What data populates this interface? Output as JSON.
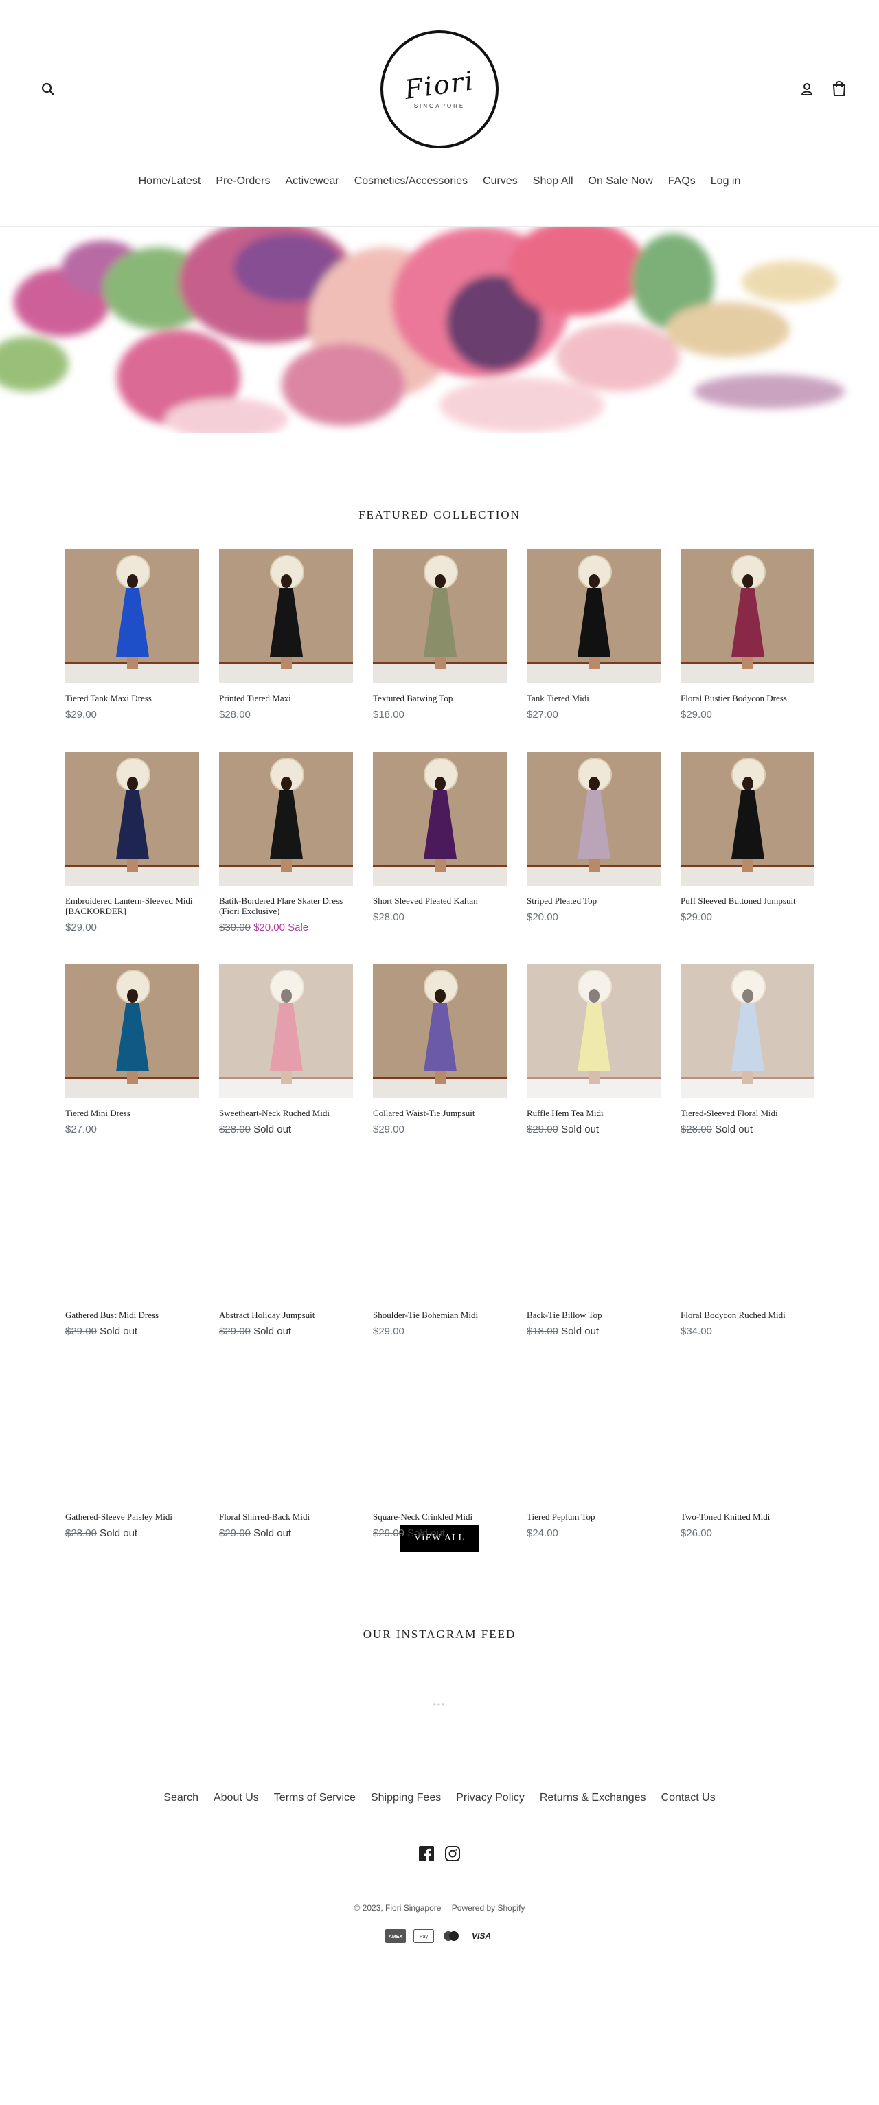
{
  "header": {
    "logo_text": "Fiori",
    "logo_subtext": "SINGAPORE",
    "nav": [
      "Home/Latest",
      "Pre-Orders",
      "Activewear",
      "Cosmetics/Accessories",
      "Curves",
      "Shop All",
      "On Sale Now",
      "FAQs",
      "Log in"
    ]
  },
  "featured": {
    "title": "FEATURED COLLECTION",
    "products": [
      {
        "title": "Tiered Tank Maxi Dress",
        "price": "$29.00",
        "compare": "",
        "status": "",
        "dress_color": "#1f4fc8",
        "image": true
      },
      {
        "title": "Printed Tiered Maxi",
        "price": "$28.00",
        "compare": "",
        "status": "",
        "dress_color": "#141414",
        "image": true
      },
      {
        "title": "Textured Batwing Top",
        "price": "$18.00",
        "compare": "",
        "status": "",
        "dress_color": "#8a8f6a",
        "image": true
      },
      {
        "title": "Tank Tiered Midi",
        "price": "$27.00",
        "compare": "",
        "status": "",
        "dress_color": "#111111",
        "image": true
      },
      {
        "title": "Floral Bustier Bodycon Dress",
        "price": "$29.00",
        "compare": "",
        "status": "",
        "dress_color": "#8a2848",
        "image": true
      },
      {
        "title": "Embroidered Lantern-Sleeved Midi [BACKORDER]",
        "price": "$29.00",
        "compare": "",
        "status": "",
        "dress_color": "#1e2550",
        "image": true
      },
      {
        "title": "Batik-Bordered Flare Skater Dress (Fiori Exclusive)",
        "price": "$20.00",
        "compare": "$30.00",
        "status": "Sale",
        "dress_color": "#151515",
        "image": true
      },
      {
        "title": "Short Sleeved Pleated Kaftan",
        "price": "$28.00",
        "compare": "",
        "status": "",
        "dress_color": "#4a1a5a",
        "image": true
      },
      {
        "title": "Striped Pleated Top",
        "price": "$20.00",
        "compare": "",
        "status": "",
        "dress_color": "#b9a4b8",
        "image": true
      },
      {
        "title": "Puff Sleeved Buttoned Jumpsuit",
        "price": "$29.00",
        "compare": "",
        "status": "",
        "dress_color": "#121212",
        "image": true
      },
      {
        "title": "Tiered Mini Dress",
        "price": "$27.00",
        "compare": "",
        "status": "",
        "dress_color": "#0f5a84",
        "image": true
      },
      {
        "title": "Sweetheart-Neck Ruched Midi",
        "price": "",
        "compare": "$28.00",
        "status": "Sold out",
        "dress_color": "#d0506a",
        "image": true
      },
      {
        "title": "Collared Waist-Tie Jumpsuit",
        "price": "$29.00",
        "compare": "",
        "status": "",
        "dress_color": "#6a5aa8",
        "image": true
      },
      {
        "title": "Ruffle Hem Tea Midi",
        "price": "",
        "compare": "$29.00",
        "status": "Sold out",
        "dress_color": "#e4d86a",
        "image": true
      },
      {
        "title": "Tiered-Sleeved Floral Midi",
        "price": "",
        "compare": "$28.00",
        "status": "Sold out",
        "dress_color": "#9ab8d8",
        "image": true
      },
      {
        "title": "Gathered Bust Midi Dress",
        "price": "",
        "compare": "$29.00",
        "status": "Sold out",
        "image": false
      },
      {
        "title": "Abstract Holiday Jumpsuit",
        "price": "",
        "compare": "$29.00",
        "status": "Sold out",
        "image": false
      },
      {
        "title": "Shoulder-Tie Bohemian Midi",
        "price": "$29.00",
        "compare": "",
        "status": "",
        "image": false
      },
      {
        "title": "Back-Tie Billow Top",
        "price": "",
        "compare": "$18.00",
        "status": "Sold out",
        "image": false
      },
      {
        "title": "Floral Bodycon Ruched Midi",
        "price": "$34.00",
        "compare": "",
        "status": "",
        "image": false
      },
      {
        "title": "Gathered-Sleeve Paisley Midi",
        "price": "",
        "compare": "$28.00",
        "status": "Sold out",
        "image": false
      },
      {
        "title": "Floral Shirred-Back Midi",
        "price": "",
        "compare": "$29.00",
        "status": "Sold out",
        "image": false
      },
      {
        "title": "Square-Neck Crinkled Midi",
        "price": "",
        "compare": "$29.00",
        "status": "Sold out",
        "image": false
      },
      {
        "title": "Tiered Peplum Top",
        "price": "$24.00",
        "compare": "",
        "status": "",
        "image": false
      },
      {
        "title": "Two-Toned Knitted Midi",
        "price": "$26.00",
        "compare": "",
        "status": "",
        "image": false
      }
    ],
    "view_all": "VIEW ALL"
  },
  "instagram": {
    "title": "OUR INSTAGRAM FEED",
    "loading": "•••"
  },
  "footer": {
    "links": [
      "Search",
      "About Us",
      "Terms of Service",
      "Shipping Fees",
      "Privacy Policy",
      "Returns & Exchanges",
      "Contact Us"
    ],
    "copyright": "© 2023, Fiori Singapore",
    "powered": "Powered by Shopify",
    "payments": [
      "American Express",
      "Apple Pay",
      "Mastercard",
      "VISA"
    ]
  },
  "colors": {
    "sale": "#b03ca0",
    "button_bg": "#000000",
    "muted": "#69727b"
  }
}
